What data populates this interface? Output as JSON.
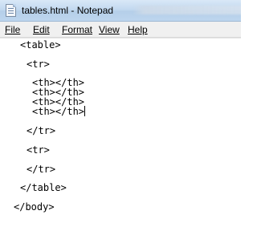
{
  "window": {
    "title": "tables.html - Notepad",
    "app_icon": "notepad-icon"
  },
  "menu": {
    "file": "File",
    "edit": "Edit",
    "format": "Format",
    "view": "View",
    "help": "Help"
  },
  "editor": {
    "lines": [
      "<table>",
      "<tr>",
      "<th></th>",
      "<th></th>",
      "<th></th>",
      "<th></th>",
      "</tr>",
      "<tr>",
      "</tr>",
      "</table>",
      "</body>"
    ]
  }
}
